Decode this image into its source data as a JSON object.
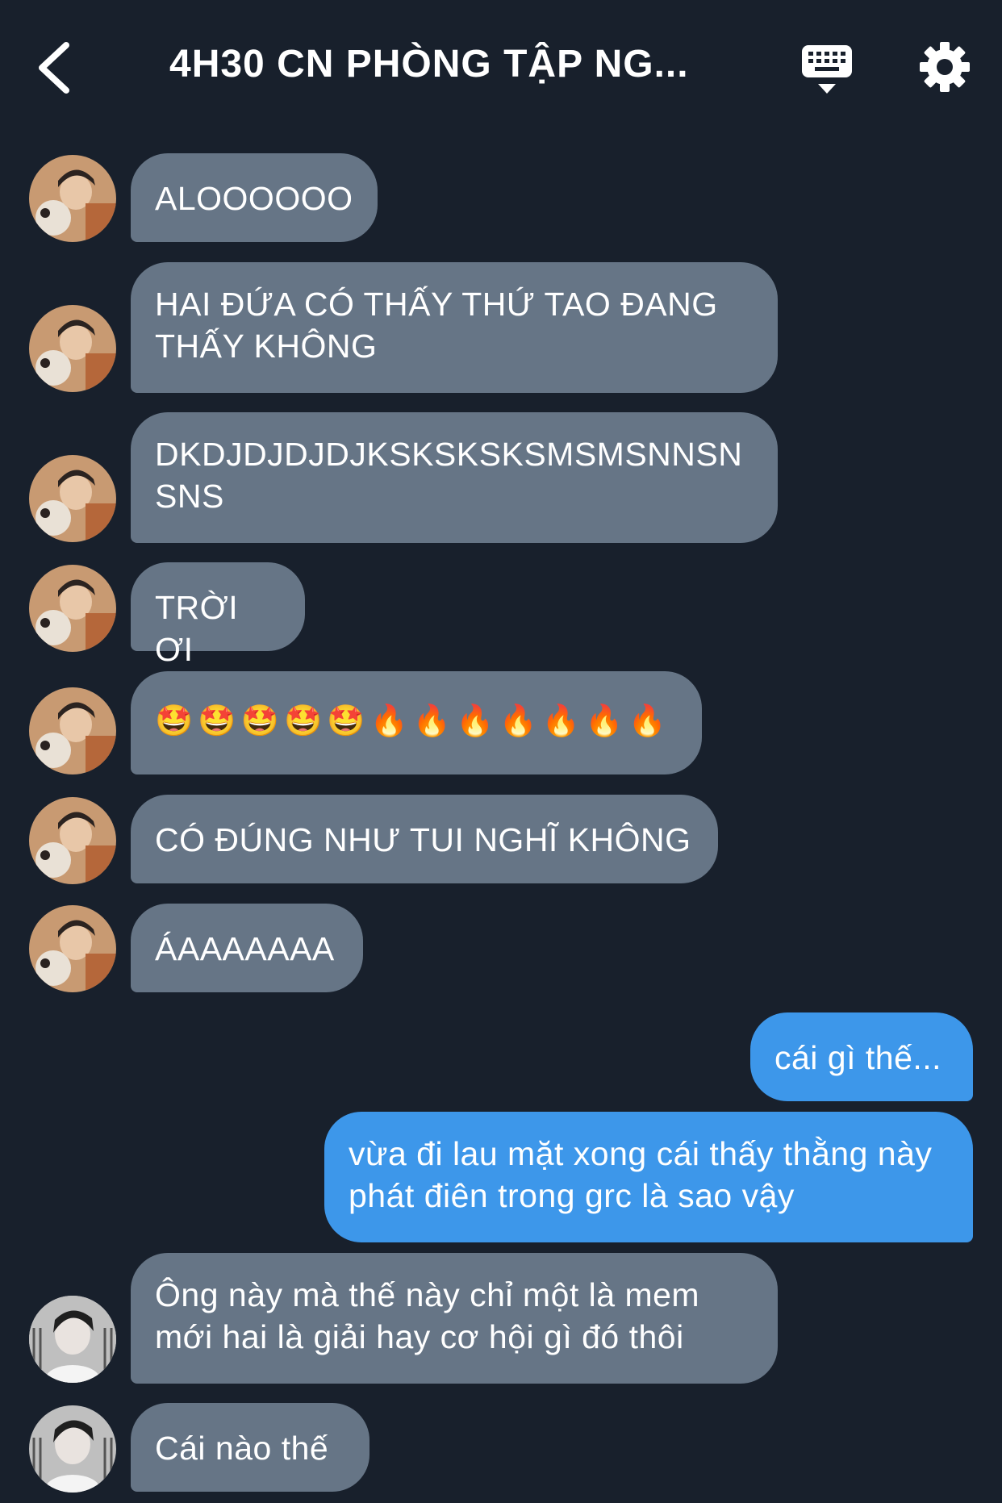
{
  "header": {
    "title": "4H30 CN PHÒNG TẬP NG..."
  },
  "messages": [
    {
      "from": "other",
      "text": "ALOOOOOO"
    },
    {
      "from": "other",
      "text": "HAI ĐỨA CÓ THẤY THỨ TAO ĐANG THẤY KHÔNG"
    },
    {
      "from": "other",
      "text": "DKDJDJDJDJKSKSKSKSMSMSNNSN SNS"
    },
    {
      "from": "other",
      "text": "TRỜI ƠI"
    },
    {
      "from": "other",
      "text": "🤩🤩🤩🤩🤩🔥🔥🔥🔥🔥🔥🔥"
    },
    {
      "from": "other",
      "text": "CÓ ĐÚNG NHƯ TUI NGHĨ KHÔNG"
    },
    {
      "from": "other",
      "text": "ÁAAAAAAA"
    },
    {
      "from": "me",
      "text": "cái gì thế..."
    },
    {
      "from": "me",
      "text": "vừa đi lau mặt xong cái thấy thằng này phát điên trong grc là sao vậy"
    },
    {
      "from": "other2",
      "text": "Ông này mà thế này chỉ một là mem mới hai là giải hay cơ hội gì đó thôi"
    },
    {
      "from": "other2",
      "text": "Cái nào thế"
    }
  ],
  "colors": {
    "background": "#18202c",
    "incoming_bubble": "#667586",
    "outgoing_bubble": "#3d97ea"
  },
  "icons": {
    "back": "chevron-left-icon",
    "keyboard": "keyboard-icon",
    "settings": "gear-icon"
  }
}
